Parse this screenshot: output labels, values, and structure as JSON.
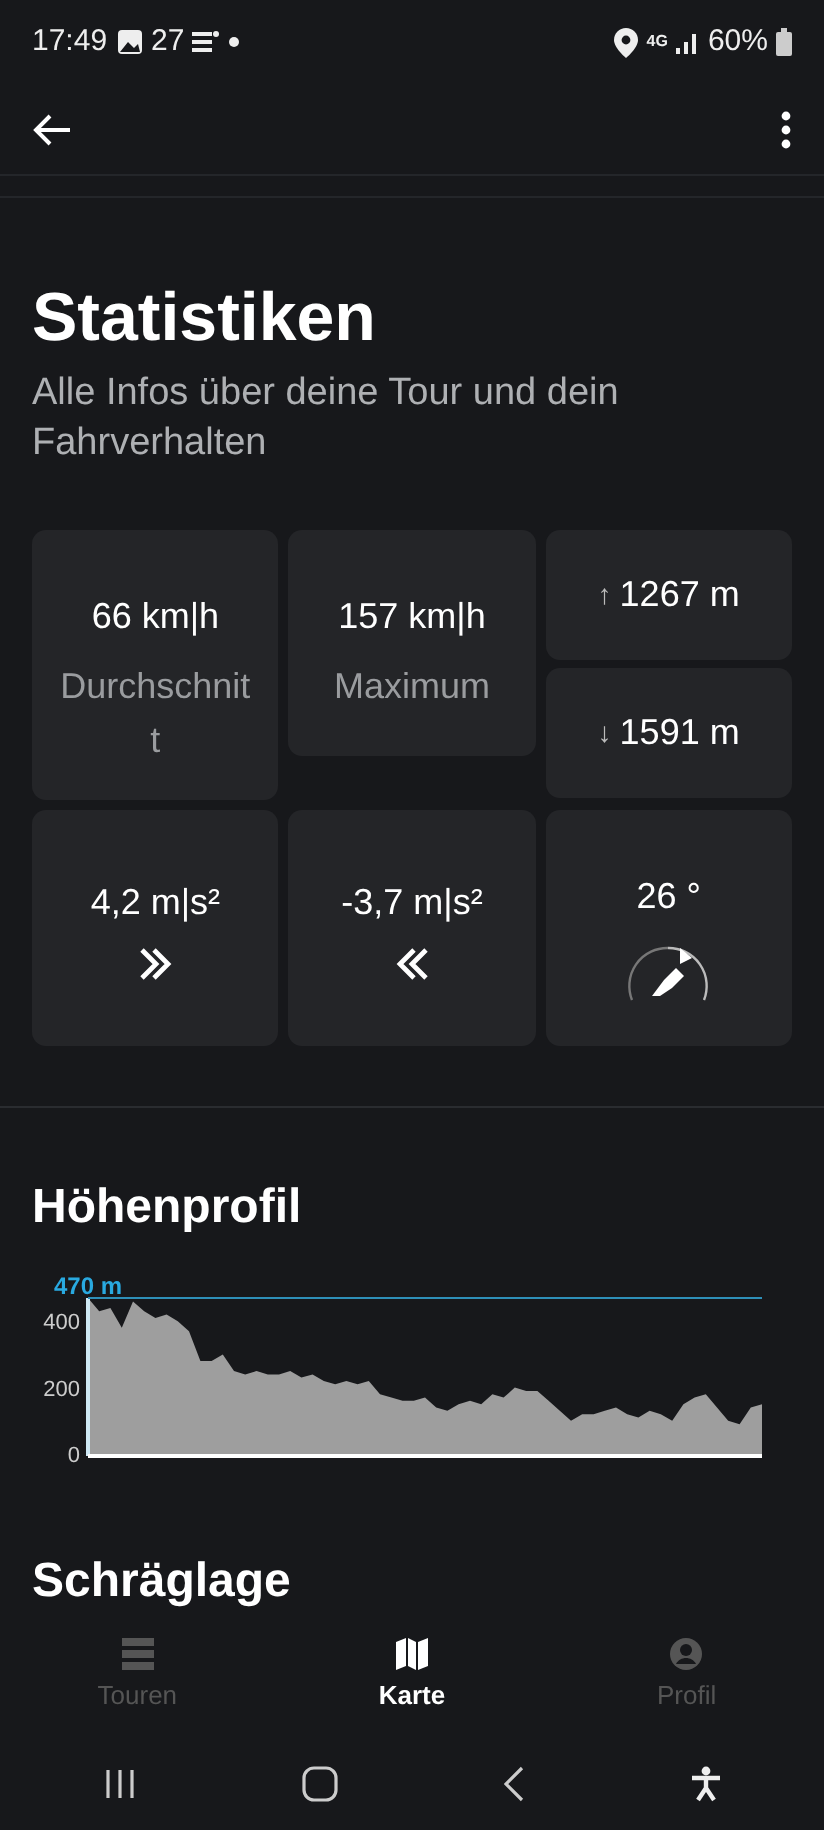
{
  "status_bar": {
    "time": "17:49",
    "notification_count": "27",
    "network": "4G",
    "battery": "60%"
  },
  "title": "Statistiken",
  "subtitle": "Alle Infos über deine Tour und dein Fahrverhalten",
  "tiles": [
    {
      "kind": "speed",
      "value": "66 km|h",
      "label": "Durchschnitt"
    },
    {
      "kind": "speed",
      "value": "157 km|h",
      "label": "Maximum"
    },
    {
      "kind": "elevation",
      "parts": [
        {
          "arrow": "↑",
          "value": "1267 m"
        },
        {
          "arrow": "↓",
          "value": "1591 m"
        }
      ]
    },
    {
      "kind": "acceleration",
      "value": "4,2 m|s²"
    },
    {
      "kind": "deceleration",
      "value": "-3,7 m|s²"
    },
    {
      "kind": "lean",
      "value": "26 °"
    }
  ],
  "elevation_section": {
    "heading": "Höhenprofil",
    "chart_data": {
      "type": "area",
      "ylim": [
        0,
        470
      ],
      "yticks": [
        0,
        200,
        400
      ],
      "annotations": [
        {
          "y": 470,
          "text": "470 m"
        }
      ],
      "series": [
        {
          "color": "#9e9e9e",
          "values": [
            470,
            430,
            440,
            380,
            460,
            430,
            410,
            420,
            400,
            370,
            280,
            280,
            300,
            250,
            240,
            250,
            240,
            240,
            250,
            230,
            240,
            220,
            210,
            220,
            210,
            220,
            180,
            170,
            160,
            160,
            170,
            140,
            130,
            150,
            160,
            150,
            180,
            170,
            200,
            190,
            190,
            160,
            130,
            100,
            120,
            120,
            130,
            140,
            120,
            110,
            130,
            120,
            100,
            150,
            170,
            180,
            140,
            100,
            90,
            140,
            150
          ]
        }
      ]
    }
  },
  "next_heading": "Schräglage",
  "bottom_nav": [
    {
      "label": "Touren",
      "selected": false
    },
    {
      "label": "Karte",
      "selected": true
    },
    {
      "label": "Profil",
      "selected": false
    }
  ]
}
